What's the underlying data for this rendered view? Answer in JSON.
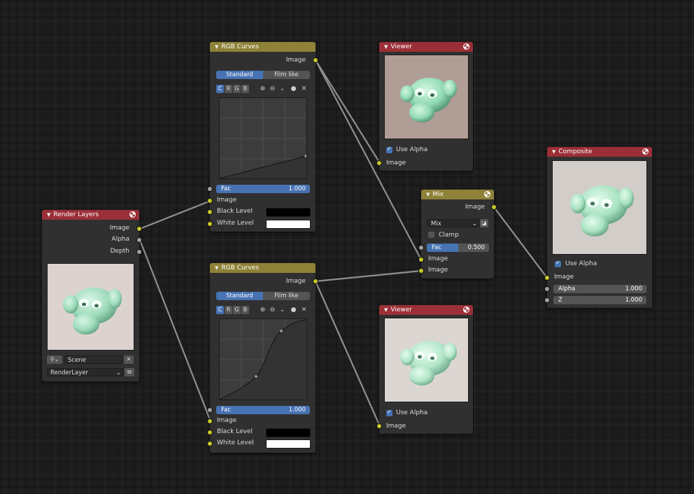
{
  "nodes": {
    "render_layers": {
      "title": "Render Layers",
      "outputs": [
        "Image",
        "Alpha",
        "Depth"
      ],
      "scene_value": "Scene",
      "layer_value": "RenderLayer"
    },
    "rgb_curves_top": {
      "title": "RGB Curves",
      "output": "Image",
      "modes": [
        "Standard",
        "Film like"
      ],
      "active_mode": "Standard",
      "channels": [
        "C",
        "R",
        "G",
        "B"
      ],
      "active_channel": "C",
      "fac_label": "Fac",
      "fac_value": "1.000",
      "inputs": [
        "Image",
        "Black Level",
        "White Level"
      ],
      "black_level_color": "#000000",
      "white_level_color": "#ffffff"
    },
    "rgb_curves_bottom": {
      "title": "RGB Curves",
      "output": "Image",
      "modes": [
        "Standard",
        "Film like"
      ],
      "active_mode": "Standard",
      "channels": [
        "C",
        "R",
        "G",
        "B"
      ],
      "active_channel": "C",
      "fac_label": "Fac",
      "fac_value": "1.000",
      "inputs": [
        "Image",
        "Black Level",
        "White Level"
      ],
      "black_level_color": "#000000",
      "white_level_color": "#ffffff"
    },
    "viewer_top": {
      "title": "Viewer",
      "use_alpha_label": "Use Alpha",
      "use_alpha": true,
      "input": "Image"
    },
    "viewer_bottom": {
      "title": "Viewer",
      "use_alpha_label": "Use Alpha",
      "use_alpha": true,
      "input": "Image"
    },
    "mix": {
      "title": "Mix",
      "output": "Image",
      "blend_mode": "Mix",
      "clamp_label": "Clamp",
      "clamp": false,
      "fac_label": "Fac",
      "fac_value": "0.500",
      "inputs": [
        "Image",
        "Image"
      ]
    },
    "composite": {
      "title": "Composite",
      "use_alpha_label": "Use Alpha",
      "use_alpha": true,
      "input": "Image",
      "alpha_label": "Alpha",
      "alpha_value": "1.000",
      "z_label": "Z",
      "z_value": "1.000"
    }
  },
  "colors": {
    "header_olive": "#8e8238",
    "header_red": "#9b2f37",
    "accent_blue": "#4772b3",
    "socket_yellow": "#c7c729",
    "socket_gray": "#a1a1a1",
    "wire": "#8f8f8f"
  },
  "icons": {
    "collapse": "triangle-down-icon",
    "render": "render-icon",
    "zoom_in": "zoom-in-icon",
    "zoom_out": "zoom-out-icon",
    "chevron": "chevron-down-icon",
    "clip": "dot-icon",
    "delete": "close-icon",
    "scene": "scene-icon",
    "browse": "browse-icon"
  }
}
